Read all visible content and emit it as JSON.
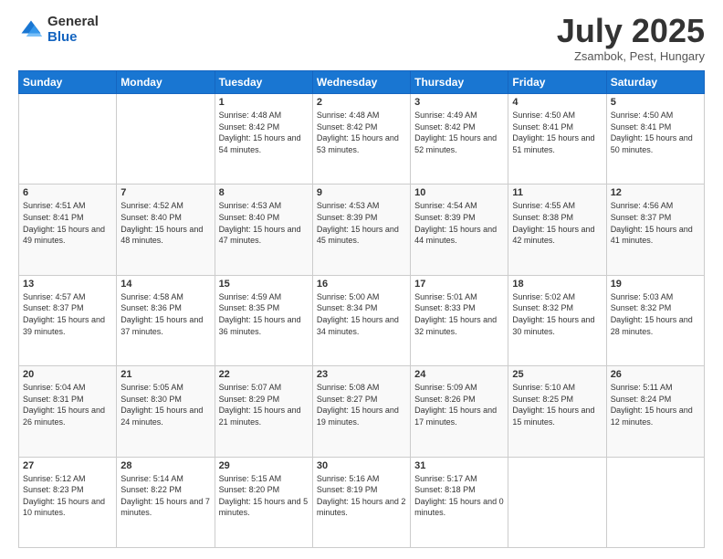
{
  "logo": {
    "general": "General",
    "blue": "Blue"
  },
  "header": {
    "month": "July 2025",
    "location": "Zsambok, Pest, Hungary"
  },
  "weekdays": [
    "Sunday",
    "Monday",
    "Tuesday",
    "Wednesday",
    "Thursday",
    "Friday",
    "Saturday"
  ],
  "weeks": [
    [
      null,
      null,
      {
        "day": 1,
        "sunrise": "4:48 AM",
        "sunset": "8:42 PM",
        "daylight": "15 hours and 54 minutes."
      },
      {
        "day": 2,
        "sunrise": "4:48 AM",
        "sunset": "8:42 PM",
        "daylight": "15 hours and 53 minutes."
      },
      {
        "day": 3,
        "sunrise": "4:49 AM",
        "sunset": "8:42 PM",
        "daylight": "15 hours and 52 minutes."
      },
      {
        "day": 4,
        "sunrise": "4:50 AM",
        "sunset": "8:41 PM",
        "daylight": "15 hours and 51 minutes."
      },
      {
        "day": 5,
        "sunrise": "4:50 AM",
        "sunset": "8:41 PM",
        "daylight": "15 hours and 50 minutes."
      }
    ],
    [
      {
        "day": 6,
        "sunrise": "4:51 AM",
        "sunset": "8:41 PM",
        "daylight": "15 hours and 49 minutes."
      },
      {
        "day": 7,
        "sunrise": "4:52 AM",
        "sunset": "8:40 PM",
        "daylight": "15 hours and 48 minutes."
      },
      {
        "day": 8,
        "sunrise": "4:53 AM",
        "sunset": "8:40 PM",
        "daylight": "15 hours and 47 minutes."
      },
      {
        "day": 9,
        "sunrise": "4:53 AM",
        "sunset": "8:39 PM",
        "daylight": "15 hours and 45 minutes."
      },
      {
        "day": 10,
        "sunrise": "4:54 AM",
        "sunset": "8:39 PM",
        "daylight": "15 hours and 44 minutes."
      },
      {
        "day": 11,
        "sunrise": "4:55 AM",
        "sunset": "8:38 PM",
        "daylight": "15 hours and 42 minutes."
      },
      {
        "day": 12,
        "sunrise": "4:56 AM",
        "sunset": "8:37 PM",
        "daylight": "15 hours and 41 minutes."
      }
    ],
    [
      {
        "day": 13,
        "sunrise": "4:57 AM",
        "sunset": "8:37 PM",
        "daylight": "15 hours and 39 minutes."
      },
      {
        "day": 14,
        "sunrise": "4:58 AM",
        "sunset": "8:36 PM",
        "daylight": "15 hours and 37 minutes."
      },
      {
        "day": 15,
        "sunrise": "4:59 AM",
        "sunset": "8:35 PM",
        "daylight": "15 hours and 36 minutes."
      },
      {
        "day": 16,
        "sunrise": "5:00 AM",
        "sunset": "8:34 PM",
        "daylight": "15 hours and 34 minutes."
      },
      {
        "day": 17,
        "sunrise": "5:01 AM",
        "sunset": "8:33 PM",
        "daylight": "15 hours and 32 minutes."
      },
      {
        "day": 18,
        "sunrise": "5:02 AM",
        "sunset": "8:32 PM",
        "daylight": "15 hours and 30 minutes."
      },
      {
        "day": 19,
        "sunrise": "5:03 AM",
        "sunset": "8:32 PM",
        "daylight": "15 hours and 28 minutes."
      }
    ],
    [
      {
        "day": 20,
        "sunrise": "5:04 AM",
        "sunset": "8:31 PM",
        "daylight": "15 hours and 26 minutes."
      },
      {
        "day": 21,
        "sunrise": "5:05 AM",
        "sunset": "8:30 PM",
        "daylight": "15 hours and 24 minutes."
      },
      {
        "day": 22,
        "sunrise": "5:07 AM",
        "sunset": "8:29 PM",
        "daylight": "15 hours and 21 minutes."
      },
      {
        "day": 23,
        "sunrise": "5:08 AM",
        "sunset": "8:27 PM",
        "daylight": "15 hours and 19 minutes."
      },
      {
        "day": 24,
        "sunrise": "5:09 AM",
        "sunset": "8:26 PM",
        "daylight": "15 hours and 17 minutes."
      },
      {
        "day": 25,
        "sunrise": "5:10 AM",
        "sunset": "8:25 PM",
        "daylight": "15 hours and 15 minutes."
      },
      {
        "day": 26,
        "sunrise": "5:11 AM",
        "sunset": "8:24 PM",
        "daylight": "15 hours and 12 minutes."
      }
    ],
    [
      {
        "day": 27,
        "sunrise": "5:12 AM",
        "sunset": "8:23 PM",
        "daylight": "15 hours and 10 minutes."
      },
      {
        "day": 28,
        "sunrise": "5:14 AM",
        "sunset": "8:22 PM",
        "daylight": "15 hours and 7 minutes."
      },
      {
        "day": 29,
        "sunrise": "5:15 AM",
        "sunset": "8:20 PM",
        "daylight": "15 hours and 5 minutes."
      },
      {
        "day": 30,
        "sunrise": "5:16 AM",
        "sunset": "8:19 PM",
        "daylight": "15 hours and 2 minutes."
      },
      {
        "day": 31,
        "sunrise": "5:17 AM",
        "sunset": "8:18 PM",
        "daylight": "15 hours and 0 minutes."
      },
      null,
      null
    ]
  ]
}
